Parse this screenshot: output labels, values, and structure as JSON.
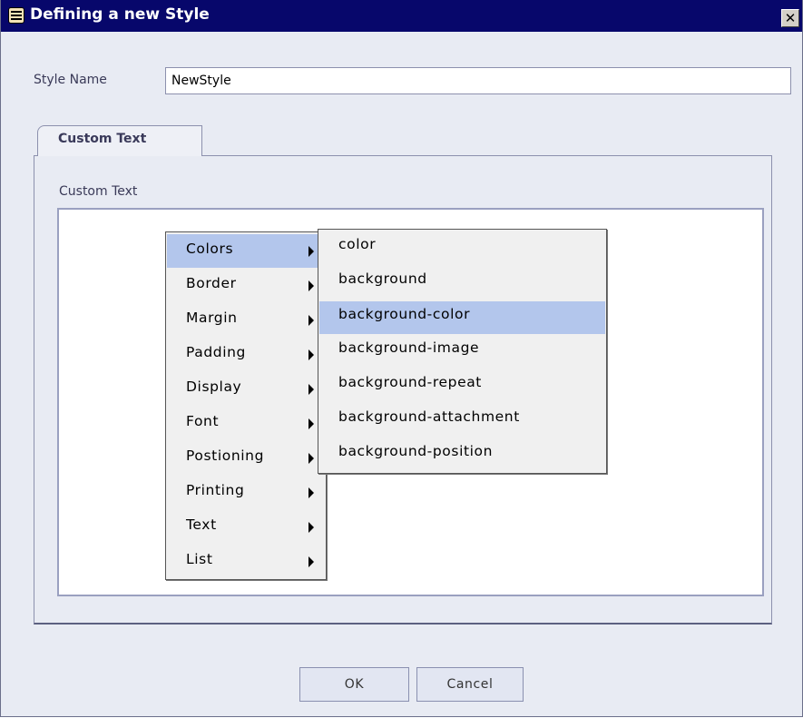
{
  "window": {
    "title": "Defining a new Style",
    "close_symbol": "✕"
  },
  "style_name": {
    "label": "Style Name",
    "value": "NewStyle"
  },
  "tabs": [
    {
      "label": "Custom Text",
      "active": true
    }
  ],
  "panel": {
    "label": "Custom Text"
  },
  "context_menu": {
    "items": [
      {
        "label": "Colors",
        "has_submenu": true,
        "highlighted": true
      },
      {
        "label": "Border",
        "has_submenu": true
      },
      {
        "label": "Margin",
        "has_submenu": true
      },
      {
        "label": "Padding",
        "has_submenu": true
      },
      {
        "label": "Display",
        "has_submenu": true
      },
      {
        "label": "Font",
        "has_submenu": true
      },
      {
        "label": "Postioning",
        "has_submenu": true
      },
      {
        "label": "Printing",
        "has_submenu": true
      },
      {
        "label": "Text",
        "has_submenu": true
      },
      {
        "label": "List",
        "has_submenu": true
      }
    ],
    "submenu_items": [
      {
        "label": "color"
      },
      {
        "label": "background"
      },
      {
        "label": "background-color",
        "highlighted": true
      },
      {
        "label": "background-image"
      },
      {
        "label": "background-repeat"
      },
      {
        "label": "background-attachment"
      },
      {
        "label": "background-position"
      }
    ]
  },
  "buttons": {
    "ok": "OK",
    "cancel": "Cancel"
  },
  "colors": {
    "titlebar": "#07076b",
    "dialog_bg": "#e8ebf3",
    "menu_highlight": "#b3c6ec"
  },
  "icons": {
    "title": "app-icon",
    "close": "close-icon",
    "submenu": "submenu-arrow-icon"
  }
}
